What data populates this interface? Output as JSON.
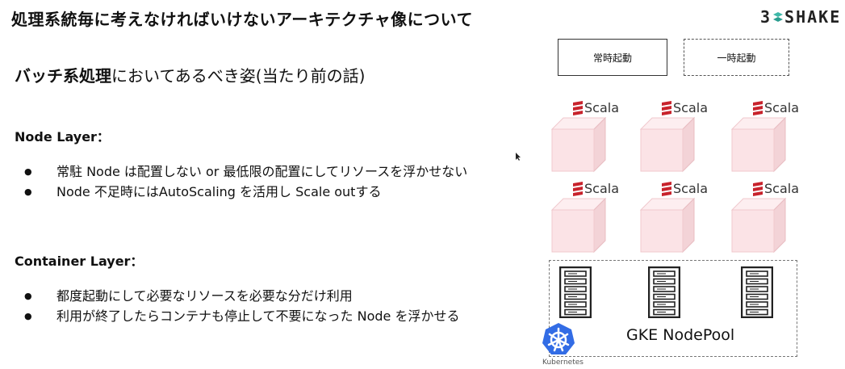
{
  "header": {
    "title": "処理系統毎に考えなければいけないアーキテクチャ像について",
    "brand_left": "3",
    "brand_right": "SHAKE"
  },
  "subtitle": {
    "bold": "バッチ系処理",
    "rest": "においてあるべき姿(当たり前の話)"
  },
  "sections": [
    {
      "heading": "Node Layer：",
      "items": [
        "常駐 Node は配置しない or 最低限の配置にしてリソースを浮かせない",
        "Node 不足時にはAutoScaling を活用し Scale outする"
      ]
    },
    {
      "heading": "Container Layer：",
      "items": [
        "都度起動にして必要なリソースを必要な分だけ利用",
        "利用が終了したらコンテナも停止して不要になった Node を浮かせる"
      ]
    }
  ],
  "diagram": {
    "legend": {
      "resident": "常時起動",
      "temporary": "一時起動"
    },
    "containers": [
      {
        "label": "Scala"
      },
      {
        "label": "Scala"
      },
      {
        "label": "Scala"
      },
      {
        "label": "Scala"
      },
      {
        "label": "Scala"
      },
      {
        "label": "Scala"
      }
    ],
    "nodepool_label": "GKE NodePool",
    "kubernetes_label": "Kubernetes",
    "colors": {
      "cube_front": "#fbe3e6",
      "cube_top": "#fdeef0",
      "cube_side": "#f3d3d7",
      "scala_red": "#c8232c",
      "kubernetes_blue": "#326ce5",
      "brand_teal": "#3fb8a8"
    }
  }
}
